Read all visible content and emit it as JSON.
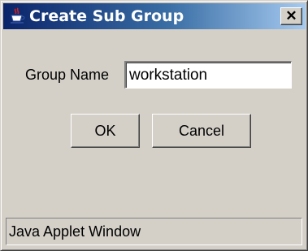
{
  "window": {
    "title": "Create Sub Group",
    "title_icon": "java-cup-icon",
    "close_glyph": "✕",
    "colors": {
      "titlebar_start": "#0a246a",
      "titlebar_end": "#a6caf0",
      "face": "#d4d0c8"
    }
  },
  "form": {
    "group_name_label": "Group Name",
    "group_name_value": "workstation"
  },
  "buttons": {
    "ok_label": "OK",
    "cancel_label": "Cancel"
  },
  "status_bar": {
    "text": "Java Applet Window"
  }
}
